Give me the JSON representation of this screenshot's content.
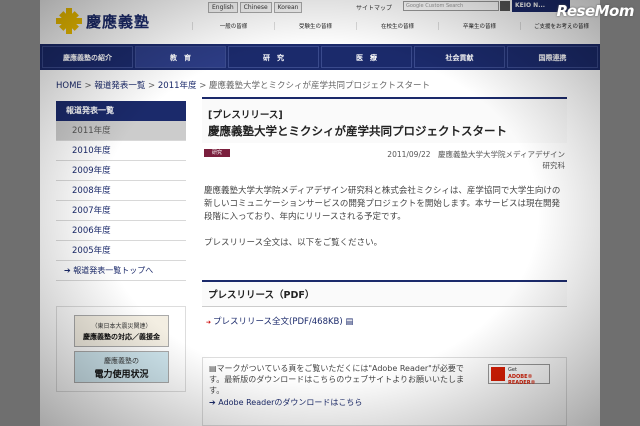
{
  "header": {
    "logo_text": "慶應義塾",
    "languages": [
      "English",
      "Chinese",
      "Korean"
    ],
    "sitemap": "サイトマップ",
    "search_placeholder": "Google Custom Search",
    "keio_net": "KEIO N...",
    "utility_links": [
      "一般の皆様",
      "受験生の皆様",
      "在校生の皆様",
      "卒業生の皆様",
      "ご支援をお考えの皆様"
    ]
  },
  "nav": {
    "items": [
      "慶應義塾の紹介",
      "教　育",
      "研　究",
      "医　療",
      "社会貢献",
      "国際連携"
    ]
  },
  "breadcrumb": {
    "home": "HOME",
    "sep": " > ",
    "list": "報道発表一覧",
    "year": "2011年度",
    "current": "慶應義塾大学とミクシィが産学共同プロジェクトスタート"
  },
  "sidebar": {
    "heading": "報道発表一覧",
    "items": [
      "2011年度",
      "2010年度",
      "2009年度",
      "2008年度",
      "2007年度",
      "2006年度",
      "2005年度"
    ],
    "top_link": "報道発表一覧トップへ"
  },
  "banners": {
    "b1_line1": "（東日本大震災関連）",
    "b1_line2": "慶應義塾の対応／義援金",
    "b2_line1": "慶應義塾の",
    "b2_line2": "電力使用状況"
  },
  "article": {
    "tag": "[プレスリリース]",
    "title": "慶應義塾大学とミクシィが産学共同プロジェクトスタート",
    "icon_label": "研究",
    "date_meta": "2011/09/22　慶應義塾大学大学院メディアデザイン研究科",
    "body": "慶應義塾大学大学院メディアデザイン研究科と株式会社ミクシィは、産学協同で大学生向けの新しいコミュニケーションサービスの開発プロジェクトを開始します。本サービスは現在開発段階に入っており、年内にリリースされる予定です。",
    "body2": "プレスリリース全文は、以下をご覧ください。",
    "pdf_heading": "プレスリリース（PDF）",
    "pdf_link": "プレスリリース全文(PDF/468KB)"
  },
  "adobe": {
    "text": "マークがついている頁をご覧いただくには\"Adobe Reader\"が必要です。最新版のダウンロードはこちらのウェブサイトよりお願いいたします。",
    "link": "Adobe Readerのダウンロードはこちら",
    "badge_line1": "Get",
    "badge_line2": "ADOBE® READER®"
  },
  "watermark": "ReseMom"
}
